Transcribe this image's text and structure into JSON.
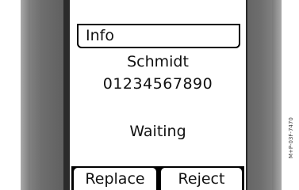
{
  "screen": {
    "header_label": "Info",
    "caller_name": "Schmidt",
    "caller_number": "01234567890",
    "call_status": "Waiting"
  },
  "softkeys": {
    "left_label": "Replace",
    "right_label": "Reject"
  },
  "figure_code": "M+P-03F-7470",
  "colors": {
    "screen_background": "#ffffff",
    "text": "#111111",
    "device_frame": "#5a5a5a"
  }
}
